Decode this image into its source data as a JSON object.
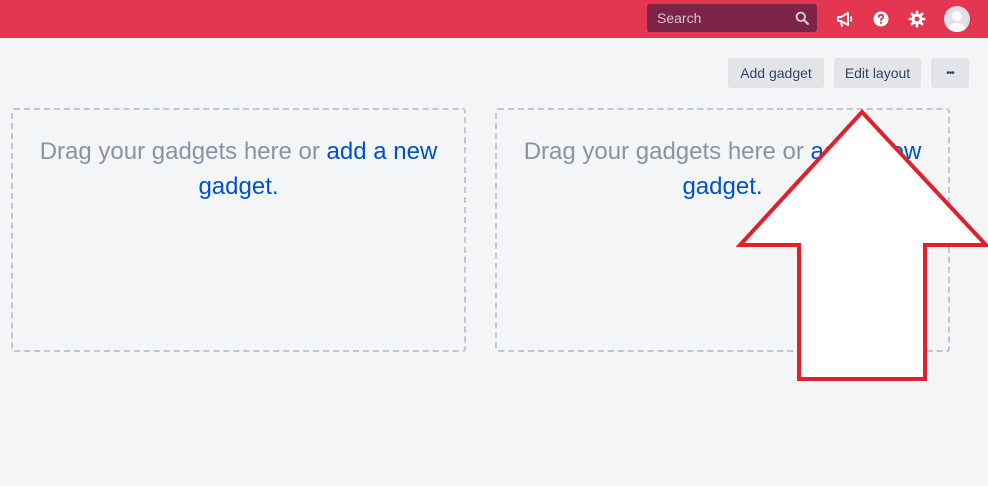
{
  "header": {
    "search": {
      "placeholder": "Search"
    },
    "icons": [
      "megaphone-icon",
      "help-icon",
      "gear-icon",
      "avatar"
    ]
  },
  "toolbar": {
    "add_gadget_label": "Add gadget",
    "edit_layout_label": "Edit layout",
    "more_label": "•••"
  },
  "columns": [
    {
      "text": "Drag your gadgets here or ",
      "link": "add a new gadget",
      "suffix": "."
    },
    {
      "text": "Drag your gadgets here or ",
      "link": "add a new gadget",
      "suffix": "."
    }
  ],
  "colors": {
    "topbar": "#e43651",
    "search_bg": "#7b2447",
    "link": "#0052cc",
    "annotation_arrow": "#e0202c"
  }
}
